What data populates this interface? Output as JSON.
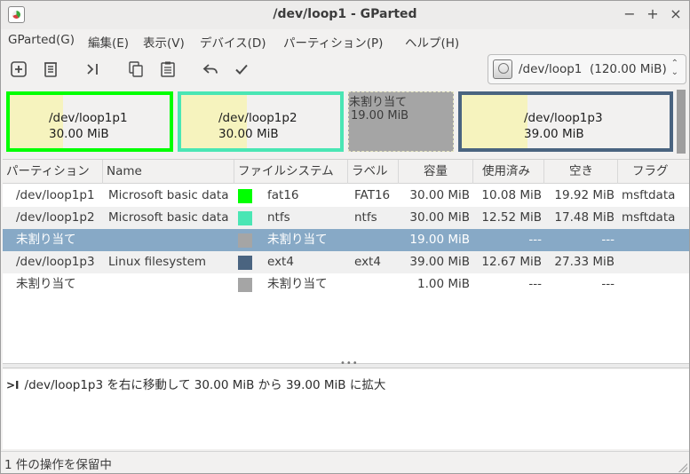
{
  "window": {
    "title": "/dev/loop1 - GParted",
    "minimize": "−",
    "maximize": "+",
    "close": "×"
  },
  "menu": [
    "GParted(G)",
    "編集(E)",
    "表示(V)",
    "デバイス(D)",
    "パーティション(P)",
    "ヘルプ(H)"
  ],
  "toolbar": {
    "icons": [
      "new-partition-icon",
      "delete-partition-icon",
      "resize-move-icon",
      "copy-icon",
      "paste-icon",
      "undo-icon",
      "apply-icon"
    ]
  },
  "device_selector": {
    "name": "/dev/loop1",
    "size": "(120.00 MiB)"
  },
  "disk_map": [
    {
      "kind": "partition",
      "name": "/dev/loop1p1",
      "size": "30.00 MiB",
      "used_fraction": 0.337,
      "border_color": "#00ff00"
    },
    {
      "kind": "partition",
      "name": "/dev/loop1p2",
      "size": "30.00 MiB",
      "used_fraction": 0.417,
      "border_color": "#4ae6b4"
    },
    {
      "kind": "unallocated",
      "name": "未割り当て",
      "size": "19.00 MiB"
    },
    {
      "kind": "partition",
      "name": "/dev/loop1p3",
      "size": "39.00 MiB",
      "used_fraction": 0.325,
      "border_color": "#4a6480"
    }
  ],
  "table": {
    "headers": [
      "パーティション",
      "Name",
      "ファイルシステム",
      "ラベル",
      "容量",
      "使用済み",
      "空き",
      "フラグ"
    ],
    "rows": [
      {
        "partition": "/dev/loop1p1",
        "name": "Microsoft basic data",
        "fs_color": "#00ff00",
        "filesystem": "fat16",
        "label": "FAT16",
        "size": "30.00 MiB",
        "used": "10.08 MiB",
        "free": "19.92 MiB",
        "flags": "msftdata"
      },
      {
        "partition": "/dev/loop1p2",
        "name": "Microsoft basic data",
        "fs_color": "#4ae6b4",
        "filesystem": "ntfs",
        "label": "ntfs",
        "size": "30.00 MiB",
        "used": "12.52 MiB",
        "free": "17.48 MiB",
        "flags": "msftdata"
      },
      {
        "partition": "未割り当て",
        "name": "",
        "fs_color": "#a5a5a5",
        "filesystem": "未割り当て",
        "label": "",
        "size": "19.00 MiB",
        "used": "---",
        "free": "---",
        "flags": ""
      },
      {
        "partition": "/dev/loop1p3",
        "name": "Linux filesystem",
        "fs_color": "#4a6480",
        "filesystem": "ext4",
        "label": "ext4",
        "size": "39.00 MiB",
        "used": "12.67 MiB",
        "free": "27.33 MiB",
        "flags": ""
      },
      {
        "partition": "未割り当て",
        "name": "",
        "fs_color": "#a5a5a5",
        "filesystem": "未割り当て",
        "label": "",
        "size": "1.00 MiB",
        "used": "---",
        "free": "---",
        "flags": ""
      }
    ]
  },
  "pending": {
    "items": [
      {
        "icon": "resize-move-icon",
        "text": "/dev/loop1p3 を右に移動して 30.00 MiB から 39.00 MiB に拡大"
      }
    ]
  },
  "status": {
    "text": "1 件の操作を保留中"
  }
}
